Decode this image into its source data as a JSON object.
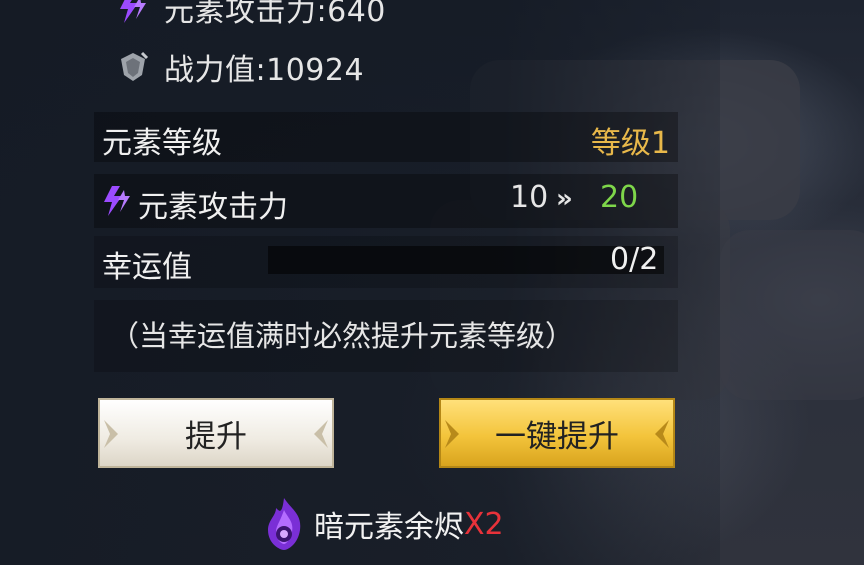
{
  "stats": {
    "element_attack_label": "元素攻击力:640",
    "power_label": "战力值:10924"
  },
  "element_level": {
    "label": "元素等级",
    "value": "等级1"
  },
  "element_attack": {
    "label": "元素攻击力",
    "current": "10",
    "arrow": "»",
    "next": "20"
  },
  "luck": {
    "label": "幸运值",
    "value": "0/2",
    "progress_fraction": 0
  },
  "hint": "（当幸运值满时必然提升元素等级）",
  "buttons": {
    "upgrade": "提升",
    "auto_upgrade": "一键提升"
  },
  "cost": {
    "item_name": "暗元素余烬",
    "count": "X2"
  },
  "colors": {
    "level_gold": "#e8b84a",
    "increase_green": "#7ed64a",
    "count_red": "#e8323a",
    "bolt_purple": "#9b4bff"
  },
  "icons": {
    "bolt": "purple-lightning-bolt-icon",
    "power": "grey-shield-crest-icon",
    "gem": "purple-dark-flame-gem-icon"
  }
}
